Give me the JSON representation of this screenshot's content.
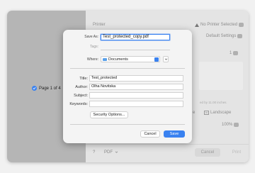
{
  "preview": {
    "page_indicator": "Page 1 of 4"
  },
  "settings": {
    "printer_label": "Printer",
    "printer_value": "No Printer Selected",
    "presets_value": "Default Settings",
    "copies_value": "1",
    "paper_size_partial": "ed by 11.00 inches",
    "orientation_prefix": "e",
    "orientation_value": "Landscape",
    "scale_value": "100%"
  },
  "bottom_bar": {
    "help_label": "?",
    "pdf_label": "PDF",
    "cancel_label": "Cancel",
    "print_label": "Print"
  },
  "save_sheet": {
    "save_as_label": "Save As:",
    "save_as_value": "Test_protected_copy.pdf",
    "tags_label": "Tags:",
    "where_label": "Where:",
    "where_value": "Documents",
    "title_label": "Title:",
    "title_value": "Test_protected",
    "author_label": "Author:",
    "author_value": "Olha Novitska",
    "subject_label": "Subject:",
    "subject_value": "",
    "keywords_label": "Keywords:",
    "keywords_value": "",
    "security_options_label": "Security Options...",
    "cancel_label": "Cancel",
    "save_label": "Save"
  },
  "colors": {
    "accent": "#3a82f0",
    "preview_bg": "#b5b5b5",
    "sheet_bg": "#f4f4f4"
  }
}
